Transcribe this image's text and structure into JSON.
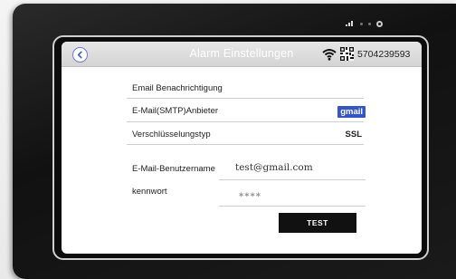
{
  "header": {
    "title": "Alarm Einstellungen",
    "device_id": "5704239593",
    "back_icon": "chevron-left-icon",
    "wifi_icon": "wifi-icon",
    "qr_icon": "qr-code-icon"
  },
  "settings": {
    "section_title": "Email Benachrichtigung",
    "provider_label": "E-Mail(SMTP)Anbieter",
    "provider_value": "gmail",
    "encryption_label": "Verschlüsselungstyp",
    "encryption_value": "SSL",
    "username_label": "E-Mail-Benutzername",
    "username_value": "test@gmail.com",
    "password_label": "kennwort",
    "password_value": "****",
    "test_button": "TEST"
  },
  "colors": {
    "accent": "#3455c2",
    "titlebar": "#dcdcdc",
    "button": "#111111"
  }
}
